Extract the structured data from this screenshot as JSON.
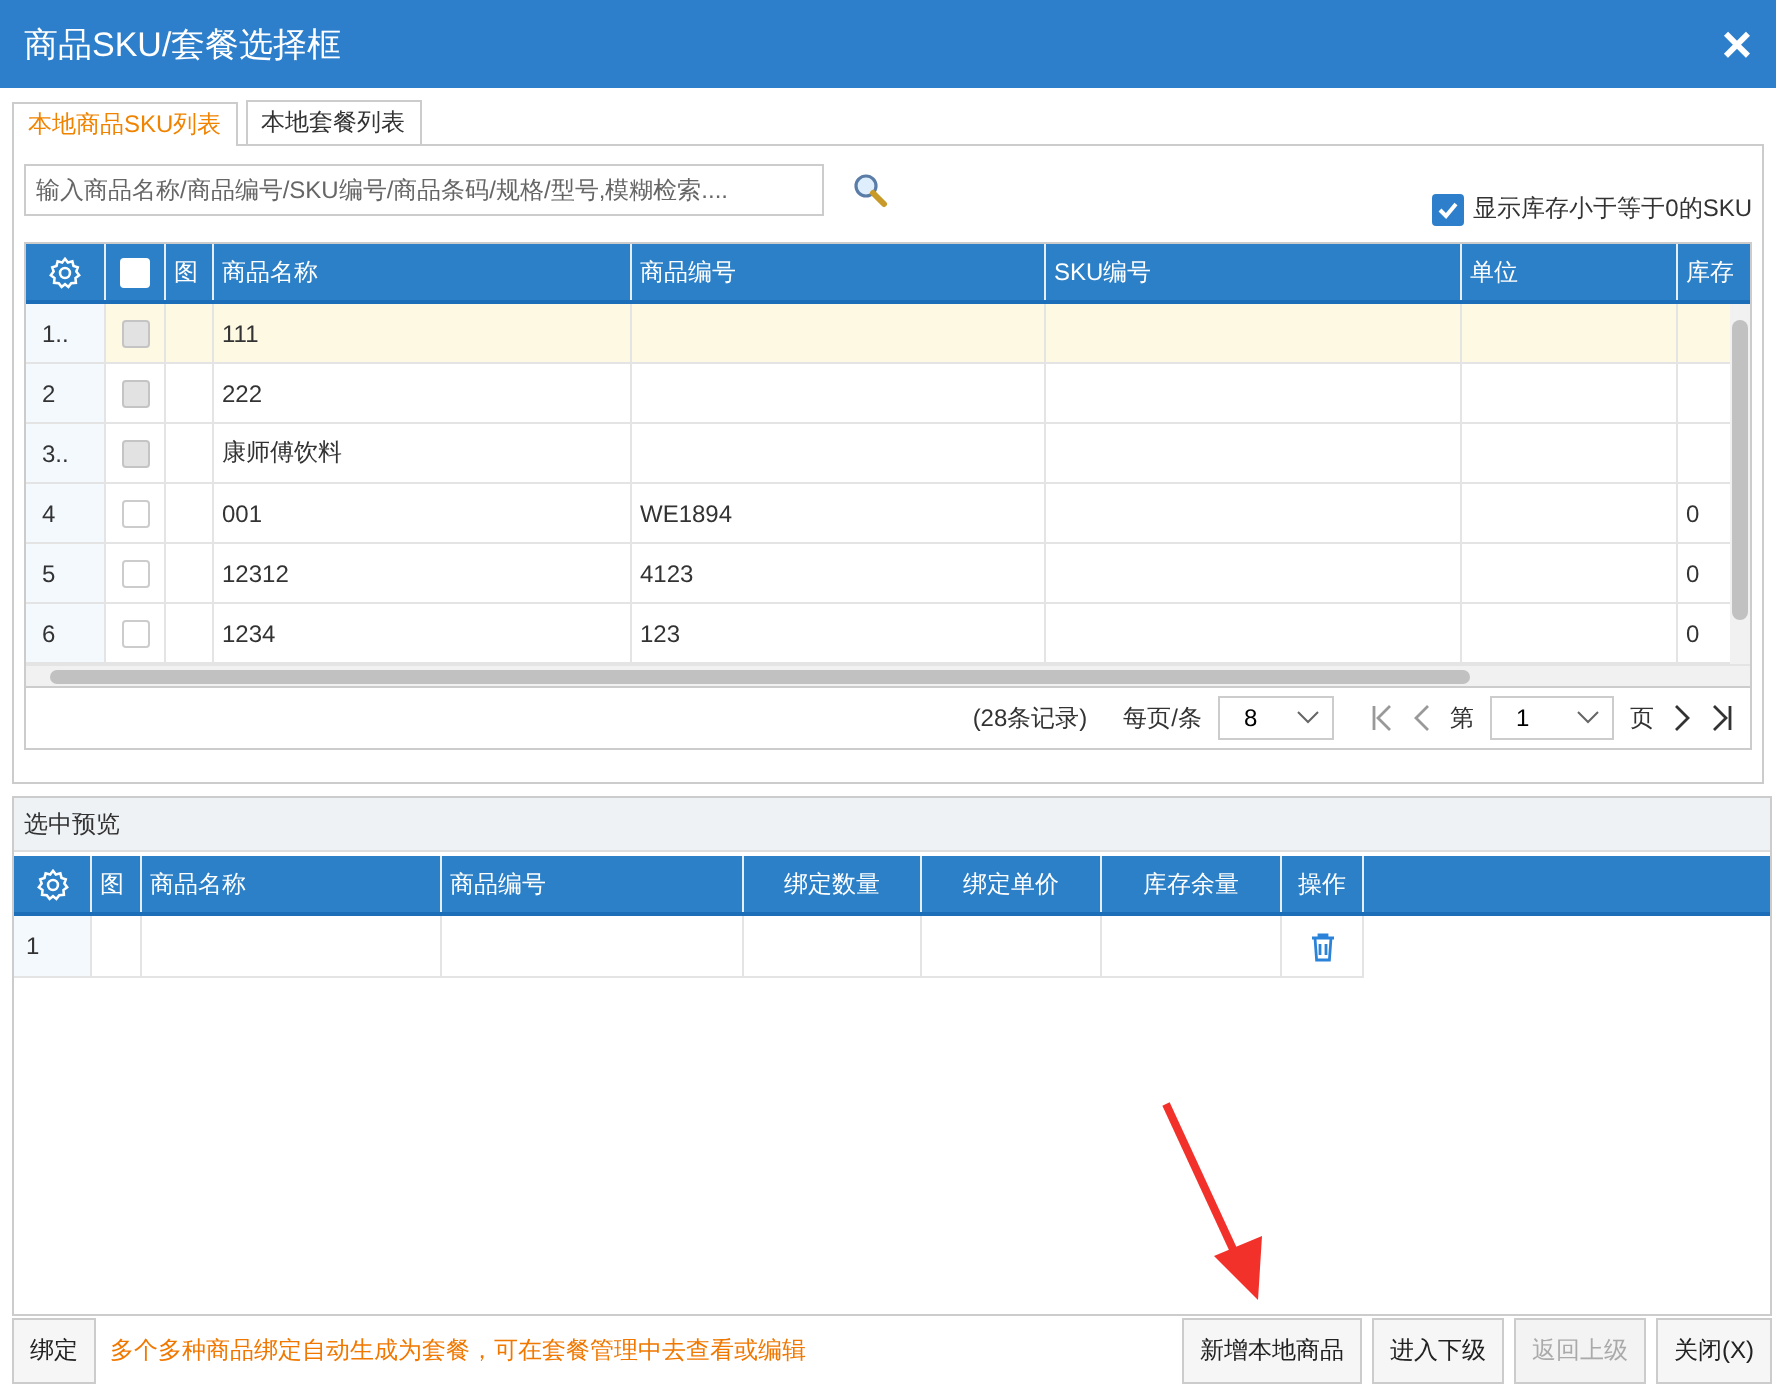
{
  "window": {
    "title": "商品SKU/套餐选择框",
    "close": "×"
  },
  "tabs": [
    {
      "label": "本地商品SKU列表",
      "selected": true
    },
    {
      "label": "本地套餐列表",
      "selected": false
    }
  ],
  "search": {
    "placeholder": "输入商品名称/商品编号/SKU编号/商品条码/规格/型号,模糊检索...."
  },
  "show_zero_stock": {
    "label": "显示库存小于等于0的SKU",
    "checked": true
  },
  "table": {
    "header_checked": false,
    "columns": [
      "图",
      "商品名称",
      "商品编号",
      "SKU编号",
      "单位",
      "库存"
    ],
    "rows": [
      {
        "index": "1..",
        "name": "111",
        "code": "",
        "sku": "",
        "unit": "",
        "stock": "",
        "disabled": true,
        "selected": true,
        "checked": false
      },
      {
        "index": "2",
        "name": "222",
        "code": "",
        "sku": "",
        "unit": "",
        "stock": "",
        "disabled": true,
        "selected": false,
        "checked": false
      },
      {
        "index": "3..",
        "name": "康师傅饮料",
        "code": "",
        "sku": "",
        "unit": "",
        "stock": "",
        "disabled": true,
        "selected": false,
        "checked": false
      },
      {
        "index": "4",
        "name": "001",
        "code": "WE1894",
        "sku": "",
        "unit": "",
        "stock": "0",
        "disabled": false,
        "selected": false,
        "checked": false
      },
      {
        "index": "5",
        "name": "12312",
        "code": "4123",
        "sku": "",
        "unit": "",
        "stock": "0",
        "disabled": false,
        "selected": false,
        "checked": false
      },
      {
        "index": "6",
        "name": "1234",
        "code": "123",
        "sku": "",
        "unit": "",
        "stock": "0",
        "disabled": false,
        "selected": false,
        "checked": false
      }
    ]
  },
  "pager": {
    "records": "(28条记录)",
    "per_page_label": "每页/条",
    "per_page": "8",
    "page_prefix": "第",
    "page": "1",
    "page_suffix": "页"
  },
  "preview": {
    "title": "选中预览",
    "columns": [
      "图",
      "商品名称",
      "商品编号",
      "绑定数量",
      "绑定单价",
      "库存余量",
      "操作"
    ],
    "rows": [
      {
        "index": "1"
      }
    ]
  },
  "footer": {
    "bind_button": "绑定",
    "hint": "多个多种商品绑定自动生成为套餐，可在套餐管理中去查看或编辑",
    "buttons": [
      {
        "label": "新增本地商品",
        "disabled": false
      },
      {
        "label": "进入下级",
        "disabled": false
      },
      {
        "label": "返回上级",
        "disabled": true
      },
      {
        "label": "关闭(X)",
        "disabled": false
      }
    ]
  }
}
